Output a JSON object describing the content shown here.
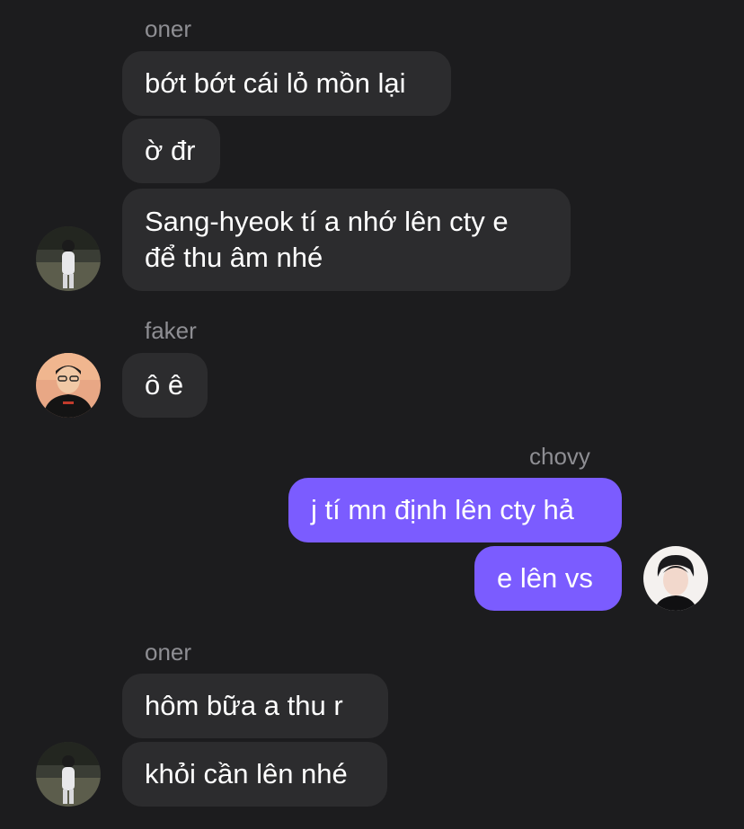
{
  "groups": [
    {
      "sender": "oner",
      "messages": [
        "bớt bớt cái lỏ mồn lại",
        "ờ đr",
        "Sang-hyeok tí a nhớ lên cty e\nđể thu âm nhé"
      ],
      "avatar": "oner-avatar-photo"
    },
    {
      "sender": "faker",
      "messages": [
        "ô ê"
      ],
      "avatar": "faker-avatar-photo"
    },
    {
      "sender": "chovy",
      "messages": [
        "j tí mn định lên cty hả",
        "e lên vs"
      ],
      "avatar": "chovy-avatar-photo"
    },
    {
      "sender": "oner",
      "messages": [
        "hôm bữa a thu r",
        "khỏi cần lên nhé"
      ],
      "avatar": "oner-avatar-photo"
    }
  ],
  "colors": {
    "background": "#1c1c1e",
    "incoming_bubble": "#2c2c2e",
    "outgoing_bubble": "#7b5cff",
    "sender_name": "#8e8e93",
    "text": "#ffffff"
  }
}
